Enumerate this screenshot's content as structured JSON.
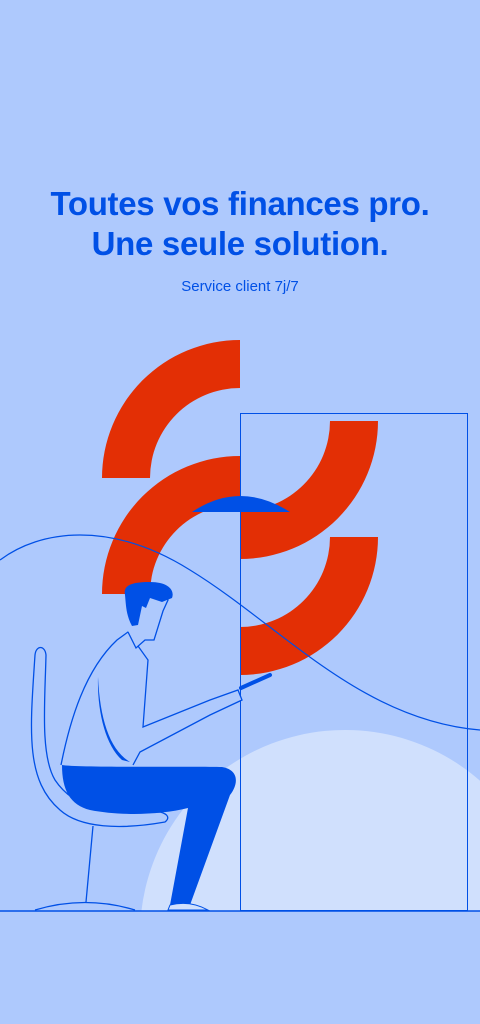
{
  "hero": {
    "title_line1": "Toutes vos finances pro.",
    "title_line2": "Une seule solution.",
    "subtitle": "Service client 7j/7"
  },
  "colors": {
    "background": "#aec9fd",
    "brand_blue": "#0050e6",
    "accent_red": "#e32f05",
    "light_circle": "#d0e0fd"
  }
}
